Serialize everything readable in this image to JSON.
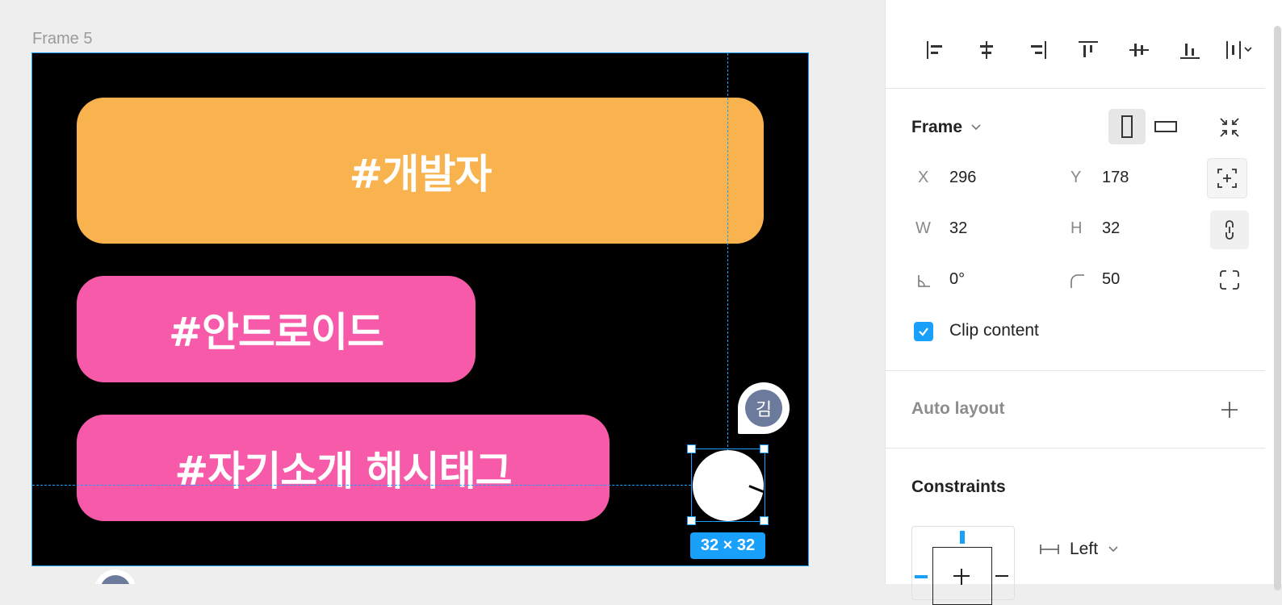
{
  "canvas": {
    "frame_label": "Frame 5",
    "tags": [
      "#개발자",
      "#안드로이드",
      "#자기소개 해시태그"
    ],
    "colors": {
      "tag_orange": "#f8b24e",
      "tag_pink": "#f65aa8",
      "selection": "#18a0fb",
      "frame_bg": "#000000"
    },
    "size_badge": "32 × 32",
    "comment_avatar_initial": "김"
  },
  "panel": {
    "align_icons": [
      "align-left-icon",
      "align-horizontal-center-icon",
      "align-right-icon",
      "align-top-icon",
      "align-vertical-center-icon",
      "align-bottom-icon",
      "distribute-icon"
    ],
    "frame": {
      "title": "Frame",
      "x_label": "X",
      "x_value": "296",
      "y_label": "Y",
      "y_value": "178",
      "w_label": "W",
      "w_value": "32",
      "h_label": "H",
      "h_value": "32",
      "rotation_value": "0°",
      "radius_value": "50",
      "clip_content_label": "Clip content",
      "clip_content_checked": true
    },
    "auto_layout_title": "Auto layout",
    "constraints": {
      "title": "Constraints",
      "horizontal_value": "Left"
    }
  }
}
